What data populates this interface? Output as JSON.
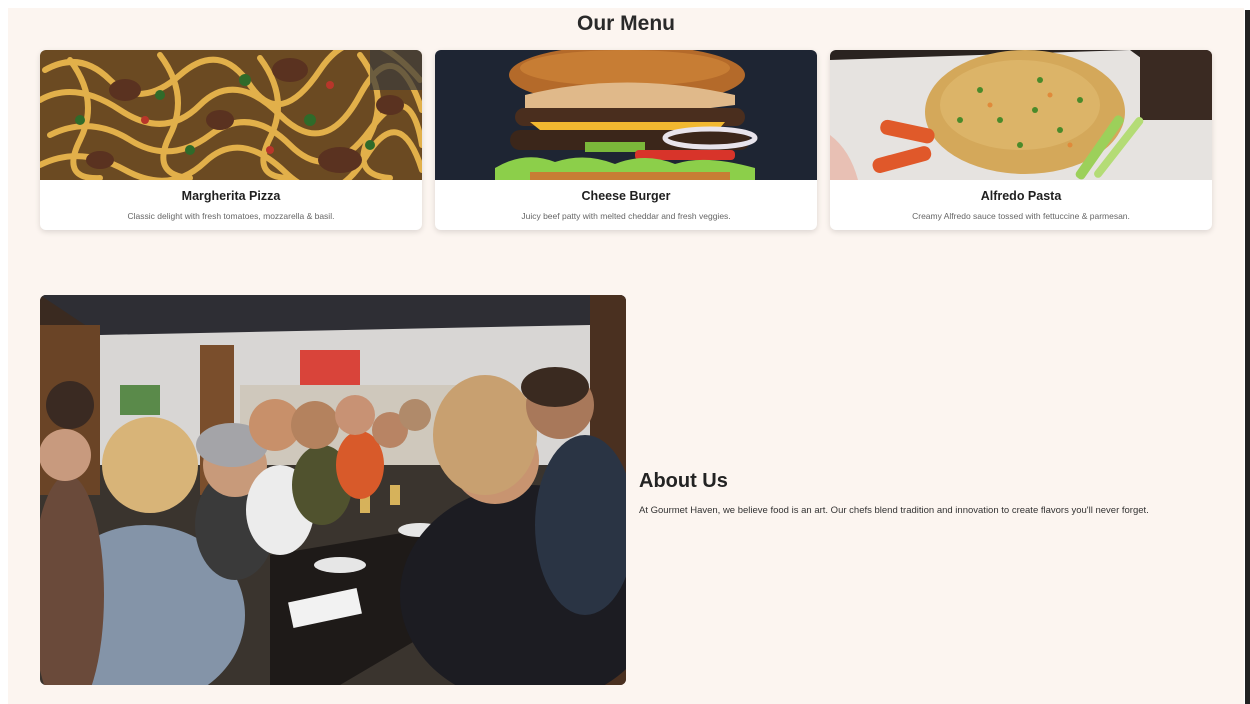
{
  "menu": {
    "title": "Our Menu",
    "items": [
      {
        "name": "Margherita Pizza",
        "description": "Classic delight with fresh tomatoes, mozzarella & basil.",
        "image": "pasta-photo"
      },
      {
        "name": "Cheese Burger",
        "description": "Juicy beef patty with melted cheddar and fresh veggies.",
        "image": "burger-photo"
      },
      {
        "name": "Alfredo Pasta",
        "description": "Creamy Alfredo sauce tossed with fettuccine & parmesan.",
        "image": "fried-rice-photo"
      }
    ]
  },
  "about": {
    "title": "About Us",
    "text": "At Gourmet Haven, we believe food is an art. Our chefs blend tradition and innovation to create flavors you'll never forget.",
    "image": "restaurant-diners-photo"
  },
  "colors": {
    "page_background": "#fcf5f0",
    "card_background": "#ffffff",
    "heading": "#2a2a2a"
  }
}
